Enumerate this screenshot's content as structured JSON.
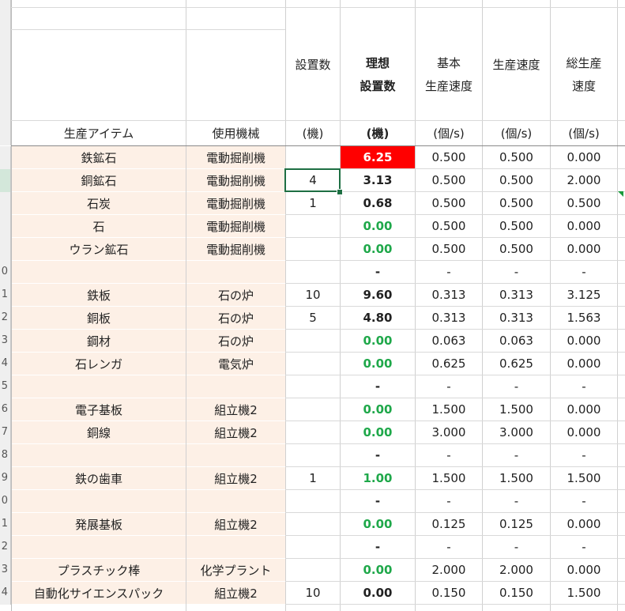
{
  "header": {
    "col_qty": "設置数",
    "col_ideal": [
      "理想",
      "設置数"
    ],
    "col_base": [
      "基本",
      "生産速度"
    ],
    "col_speed": "生産速度",
    "col_total": [
      "総生産",
      "速度"
    ]
  },
  "units": {
    "item": "生産アイテム",
    "machine": "使用機械",
    "qty": "(機)",
    "ideal": "(機)",
    "base": "(個/s)",
    "speed": "(個/s)",
    "total": "(個/s)"
  },
  "row_numbers": [
    "",
    "",
    "",
    "",
    "",
    "",
    "",
    "",
    "",
    "0",
    "1",
    "2",
    "3",
    "4",
    "5",
    "6",
    "7",
    "8",
    "9",
    "0",
    "1",
    "2",
    "3",
    "4"
  ],
  "rows": [
    {
      "item": "鉄鉱石",
      "machine": "電動掘削機",
      "qty": "",
      "ideal": "6.25",
      "ideal_style": "red",
      "base": "0.500",
      "speed": "0.500",
      "total": "0.000"
    },
    {
      "item": "銅鉱石",
      "machine": "電動掘削機",
      "qty": "4",
      "ideal": "3.13",
      "ideal_style": "bold",
      "base": "0.500",
      "speed": "0.500",
      "total": "2.000"
    },
    {
      "item": "石炭",
      "machine": "電動掘削機",
      "qty": "1",
      "ideal": "0.68",
      "ideal_style": "bold",
      "base": "0.500",
      "speed": "0.500",
      "total": "0.500"
    },
    {
      "item": "石",
      "machine": "電動掘削機",
      "qty": "",
      "ideal": "0.00",
      "ideal_style": "green",
      "base": "0.500",
      "speed": "0.500",
      "total": "0.000"
    },
    {
      "item": "ウラン鉱石",
      "machine": "電動掘削機",
      "qty": "",
      "ideal": "0.00",
      "ideal_style": "green",
      "base": "0.500",
      "speed": "0.500",
      "total": "0.000"
    },
    {
      "item": "",
      "machine": "",
      "qty": "",
      "ideal": "-",
      "ideal_style": "bold",
      "base": "-",
      "speed": "-",
      "total": "-"
    },
    {
      "item": "鉄板",
      "machine": "石の炉",
      "qty": "10",
      "ideal": "9.60",
      "ideal_style": "bold",
      "base": "0.313",
      "speed": "0.313",
      "total": "3.125"
    },
    {
      "item": "銅板",
      "machine": "石の炉",
      "qty": "5",
      "ideal": "4.80",
      "ideal_style": "bold",
      "base": "0.313",
      "speed": "0.313",
      "total": "1.563"
    },
    {
      "item": "鋼材",
      "machine": "石の炉",
      "qty": "",
      "ideal": "0.00",
      "ideal_style": "green",
      "base": "0.063",
      "speed": "0.063",
      "total": "0.000"
    },
    {
      "item": "石レンガ",
      "machine": "電気炉",
      "qty": "",
      "ideal": "0.00",
      "ideal_style": "green",
      "base": "0.625",
      "speed": "0.625",
      "total": "0.000"
    },
    {
      "item": "",
      "machine": "",
      "qty": "",
      "ideal": "-",
      "ideal_style": "bold",
      "base": "-",
      "speed": "-",
      "total": "-"
    },
    {
      "item": "電子基板",
      "machine": "組立機2",
      "qty": "",
      "ideal": "0.00",
      "ideal_style": "green",
      "base": "1.500",
      "speed": "1.500",
      "total": "0.000"
    },
    {
      "item": "銅線",
      "machine": "組立機2",
      "qty": "",
      "ideal": "0.00",
      "ideal_style": "green",
      "base": "3.000",
      "speed": "3.000",
      "total": "0.000"
    },
    {
      "item": "",
      "machine": "",
      "qty": "",
      "ideal": "-",
      "ideal_style": "bold",
      "base": "-",
      "speed": "-",
      "total": "-"
    },
    {
      "item": "鉄の歯車",
      "machine": "組立機2",
      "qty": "1",
      "ideal": "1.00",
      "ideal_style": "green",
      "base": "1.500",
      "speed": "1.500",
      "total": "1.500"
    },
    {
      "item": "",
      "machine": "",
      "qty": "",
      "ideal": "-",
      "ideal_style": "bold",
      "base": "-",
      "speed": "-",
      "total": "-"
    },
    {
      "item": "発展基板",
      "machine": "組立機2",
      "qty": "",
      "ideal": "0.00",
      "ideal_style": "green",
      "base": "0.125",
      "speed": "0.125",
      "total": "0.000"
    },
    {
      "item": "",
      "machine": "",
      "qty": "",
      "ideal": "-",
      "ideal_style": "bold",
      "base": "-",
      "speed": "-",
      "total": "-"
    },
    {
      "item": "プラスチック棒",
      "machine": "化学プラント",
      "qty": "",
      "ideal": "0.00",
      "ideal_style": "green",
      "base": "2.000",
      "speed": "2.000",
      "total": "0.000"
    },
    {
      "item": "自動化サイエンスパック",
      "machine": "組立機2",
      "qty": "10",
      "ideal": "0.00",
      "ideal_style": "bold",
      "base": "0.150",
      "speed": "0.150",
      "total": "1.500"
    }
  ]
}
